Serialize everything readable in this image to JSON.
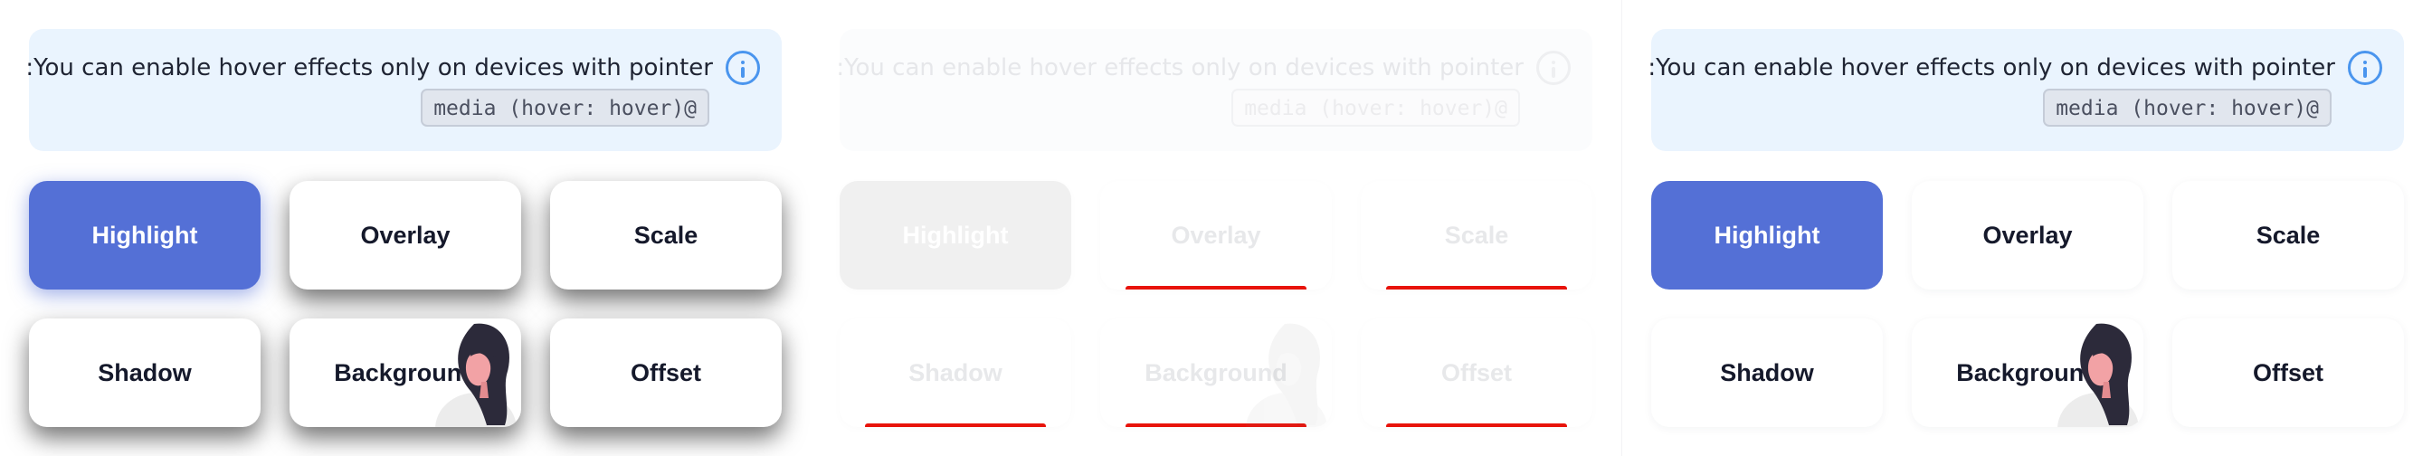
{
  "info": {
    "text": ":You can enable hover effects only on devices with pointer",
    "code": "media (hover: hover)@"
  },
  "cards": [
    "Highlight",
    "Overlay",
    "Scale",
    "Shadow",
    "Background",
    "Offset"
  ],
  "colors": {
    "accent": "#5470d6",
    "info_background": "#eaf4fe",
    "info_icon": "#4a95ee",
    "underline": "#e8130b"
  },
  "icons": [
    "info-icon",
    "person-illustration"
  ]
}
